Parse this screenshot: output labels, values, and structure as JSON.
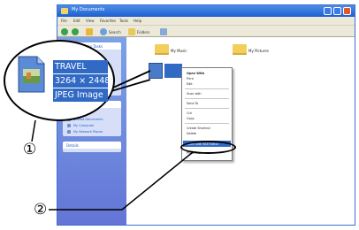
{
  "window": {
    "title": "My Documents",
    "menu": [
      "File",
      "Edit",
      "View",
      "Favorites",
      "Tools",
      "Help"
    ],
    "toolbar": {
      "search_label": "Search",
      "folders_label": "Folders"
    }
  },
  "task_pane": {
    "panels": [
      {
        "title": "File and Folder Tasks",
        "links": [
          "Rename this file",
          "Move this file",
          "Copy this file"
        ]
      },
      {
        "title": "Other Places",
        "links": [
          "Desktop",
          "Shared Documents",
          "My Computer",
          "My Network Places"
        ]
      },
      {
        "title": "Details",
        "links": []
      }
    ]
  },
  "files": {
    "folder_music": "My Music",
    "folder_pictures": "My Pictures"
  },
  "context_menu": {
    "items": [
      "Open With",
      "Print",
      "Edit",
      "Scan with",
      "Send To",
      "Cut",
      "Copy",
      "Create Shortcut",
      "Delete",
      "Rename"
    ],
    "highlighted": "Open with NLE Editor",
    "last": "Properties"
  },
  "callout": {
    "lines": [
      "TRAVEL",
      "3264 × 2448",
      "JPEG Image"
    ],
    "marker_1": "①",
    "marker_2": "②"
  }
}
